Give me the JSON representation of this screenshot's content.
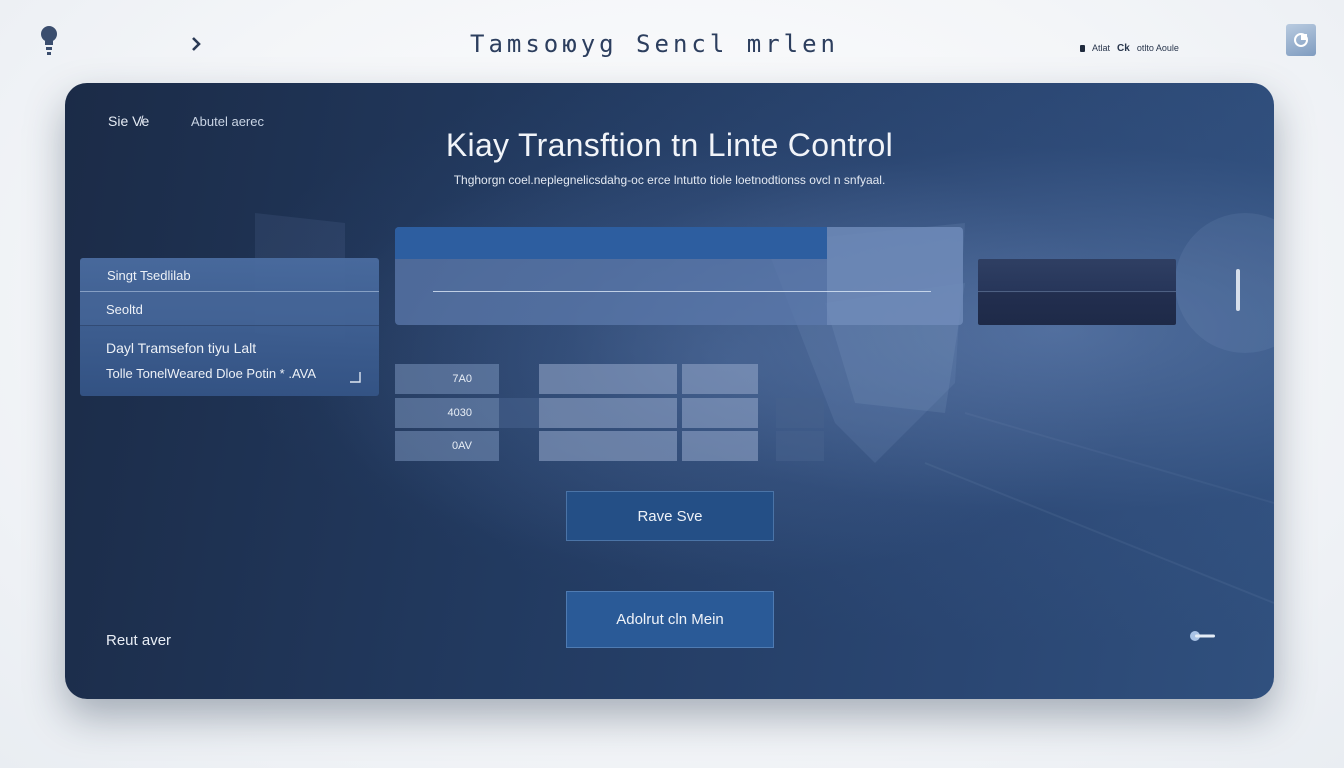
{
  "topbar": {
    "title": "Tamsoюyg Sencl mrlen",
    "status_text": "Atlat",
    "status_ok": "Ck",
    "status_extra": "otlto Aoule"
  },
  "icons": {
    "logo": "bulb-icon",
    "nav": "chevron-right-icon",
    "user": "user-icon",
    "back": "back-arrow-icon"
  },
  "panel": {
    "crumb_left": "Sie V̸e",
    "crumb_right": "Abutel aerec",
    "title": "Kiay Transftion tn Linte Control",
    "subtitle": "Thghorgn coel.neplegnelicsdahg-oc erce lntutto tiole loetnodtionss ovcl n snfyaal."
  },
  "options": {
    "items": [
      "Singt Tsedlilab",
      "Seoltd",
      "Dayl Tramsefon tiyu Lalt",
      "Tolle TonelWeared Dloe Potin * .AVA"
    ]
  },
  "grid": {
    "row_labels": [
      "7A0",
      "4030",
      "0AV"
    ]
  },
  "buttons": {
    "save": "Rave Sve",
    "admin": "Adolrut cln Mein"
  },
  "footer": {
    "reset": "Reut aver"
  },
  "colors": {
    "panel_dark": "#1b2b47",
    "panel_light": "#30507e",
    "accent_blue": "#2d5ea0",
    "button_blue": "#244f86"
  }
}
